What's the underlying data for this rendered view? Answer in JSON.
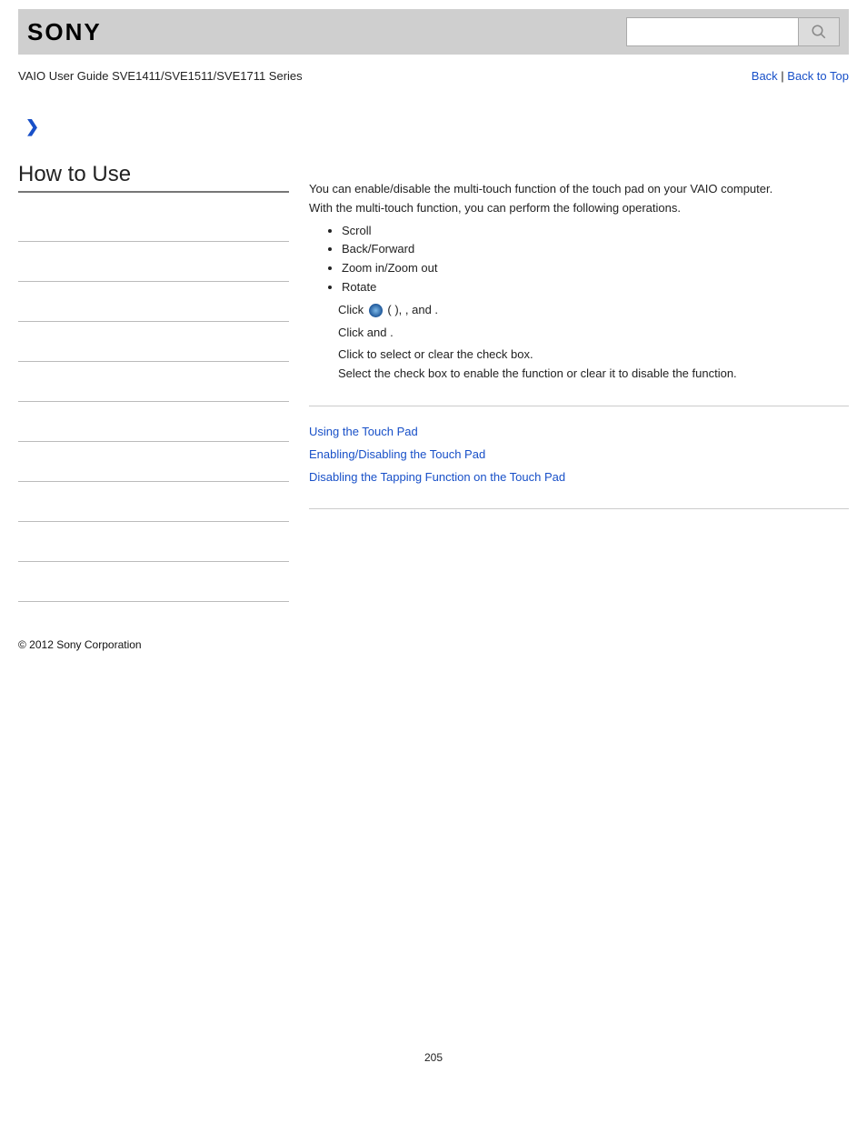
{
  "header": {
    "brand": "SONY",
    "search_placeholder": ""
  },
  "subhead": {
    "breadcrumb": "VAIO User Guide SVE1411/SVE1511/SVE1711 Series",
    "back": "Back",
    "sep": " | ",
    "top": "Back to Top"
  },
  "sidebar": {
    "title": "How to Use"
  },
  "main": {
    "intro1": "You can enable/disable the multi-touch function of the touch pad on your VAIO computer.",
    "intro2": "With the multi-touch function, you can perform the following operations.",
    "ops": [
      "Scroll",
      "Back/Forward",
      "Zoom in/Zoom out",
      "Rotate"
    ],
    "step1_a": "Click ",
    "step1_b": " (          ), ",
    "step1_c": "                                      , and ",
    "step1_d": "                                   .",
    "step2_a": "Click ",
    "step2_b": "                                       and ",
    "step2_c": "                 .",
    "step3_a": "Click to select or clear the ",
    "step3_b": "                                                                     check box.",
    "step3_c": "Select the check box to enable the function or clear it to disable the function.",
    "related": [
      "Using the Touch Pad",
      "Enabling/Disabling the Touch Pad",
      "Disabling the Tapping Function on the Touch Pad"
    ]
  },
  "footer": {
    "copyright": "© 2012 Sony Corporation",
    "page": "205"
  }
}
